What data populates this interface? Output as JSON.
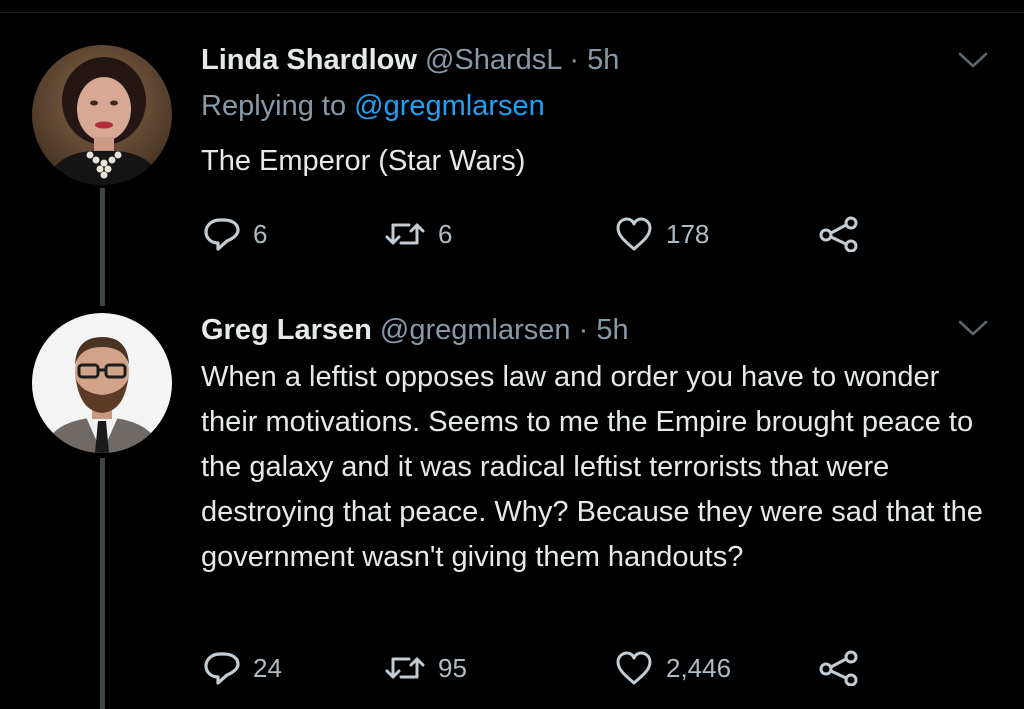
{
  "tweets": [
    {
      "display_name": "Linda Shardlow",
      "handle": "@ShardsL",
      "separator": " · ",
      "time": "5h",
      "replying_prefix": "Replying to ",
      "replying_to": "@gregmlarsen",
      "text": "The Emperor (Star Wars)",
      "stats": {
        "replies": "6",
        "retweets": "6",
        "likes": "178"
      },
      "avatar": "profile-photo-woman"
    },
    {
      "display_name": "Greg Larsen",
      "handle": "@gregmlarsen",
      "separator": " · ",
      "time": "5h",
      "text": "When a leftist opposes law and order you have to wonder their motivations. Seems to me the Empire brought peace to the galaxy and it was radical leftist terrorists that were destroying that peace. Why? Because they were sad that the government wasn't giving them handouts?",
      "stats": {
        "replies": "24",
        "retweets": "95",
        "likes": "2,446"
      },
      "avatar": "profile-photo-man"
    }
  ],
  "icons": {
    "reply": "reply-icon",
    "retweet": "retweet-icon",
    "like": "heart-icon",
    "share": "share-icon",
    "menu": "chevron-down-icon"
  },
  "colors": {
    "background": "#000000",
    "text_primary": "#e6e9ea",
    "text_secondary": "#8899a6",
    "link": "#1da1f2",
    "thread_line": "#3e4347"
  }
}
